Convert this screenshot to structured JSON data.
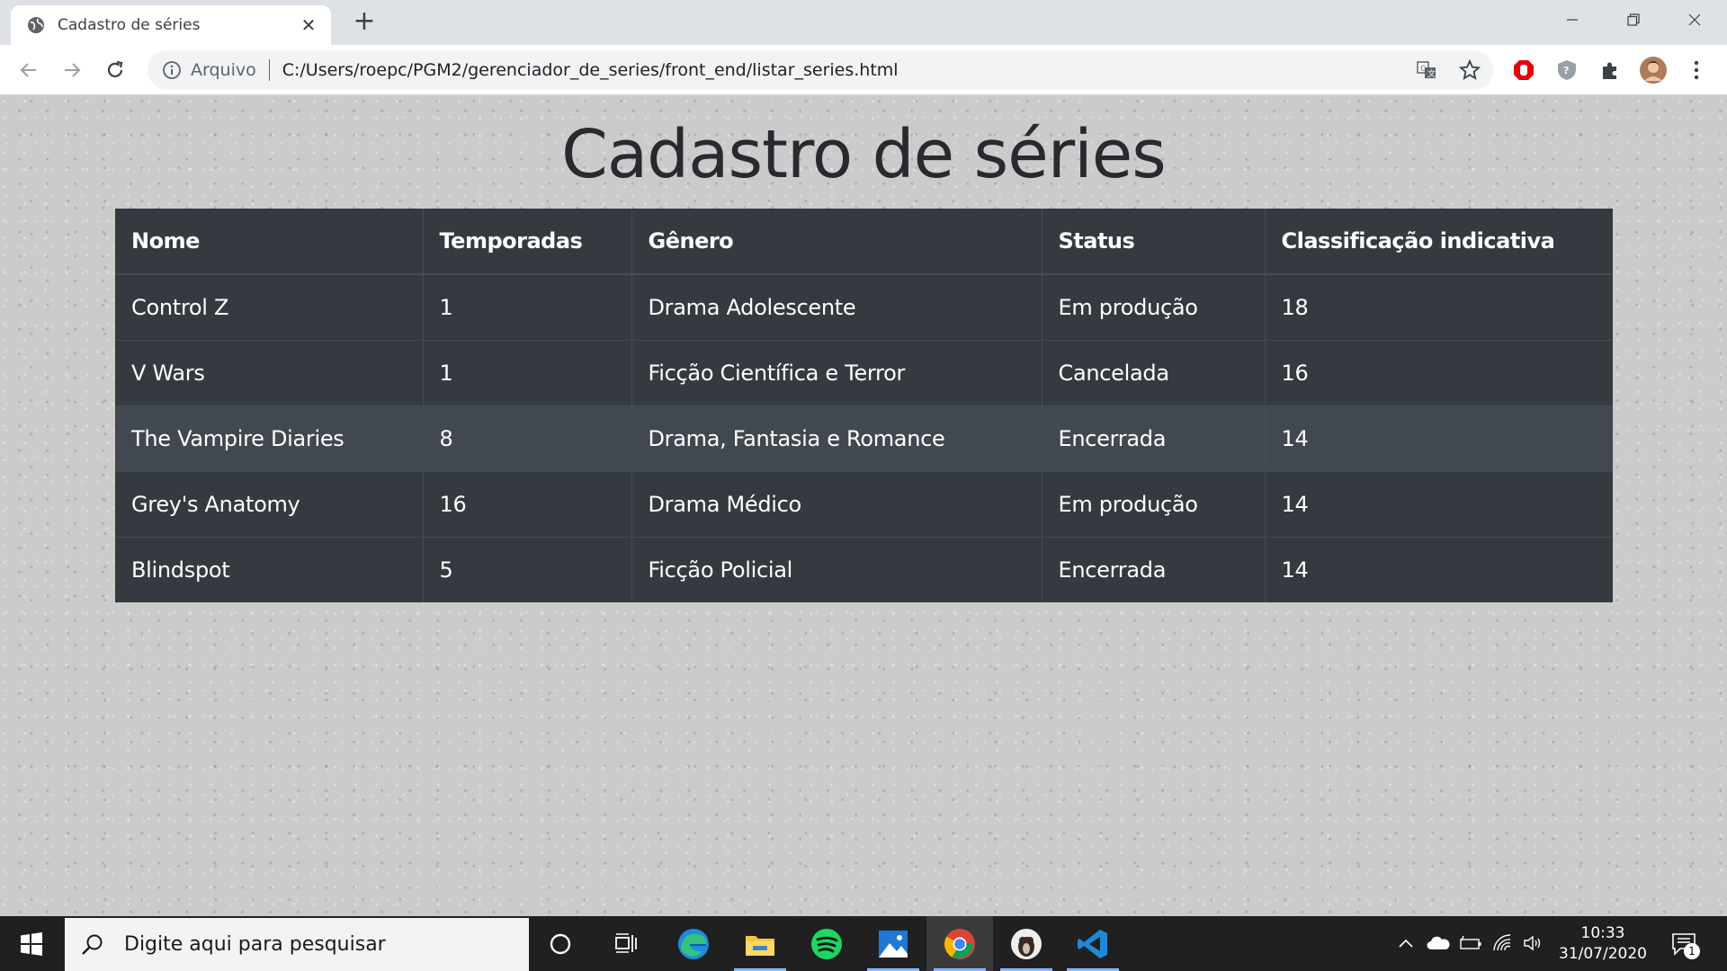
{
  "browser": {
    "tab_title": "Cadastro de séries",
    "close_tab_glyph": "✕",
    "new_tab_glyph": "+",
    "security_label": "Arquivo",
    "url": "C:/Users/roepc/PGM2/gerenciador_de_series/front_end/listar_series.html",
    "icons": [
      "globe-icon",
      "back-icon",
      "forward-icon",
      "reload-icon",
      "info-icon",
      "translate-icon",
      "star-icon",
      "adblock-icon",
      "shield-icon",
      "extensions-icon",
      "profile-avatar",
      "menu-icon"
    ]
  },
  "page": {
    "heading": "Cadastro de séries",
    "table": {
      "headers": [
        "Nome",
        "Temporadas",
        "Gênero",
        "Status",
        "Classificação indicativa"
      ],
      "rows": [
        [
          "Control Z",
          "1",
          "Drama Adolescente",
          "Em produção",
          "18"
        ],
        [
          "V Wars",
          "1",
          "Ficção Científica e Terror",
          "Cancelada",
          "16"
        ],
        [
          "The Vampire Diaries",
          "8",
          "Drama, Fantasia e Romance",
          "Encerrada",
          "14"
        ],
        [
          "Grey's Anatomy",
          "16",
          "Drama Médico",
          "Em produção",
          "14"
        ],
        [
          "Blindspot",
          "5",
          "Ficção Policial",
          "Encerrada",
          "14"
        ]
      ],
      "highlighted_row": 2,
      "colors": {
        "table_bg": "#343a40",
        "row_hover": "#42484f",
        "border": "#454d55",
        "text": "#ffffff"
      }
    }
  },
  "taskbar": {
    "search_placeholder": "Digite aqui para pesquisar",
    "apps": [
      "cortana-icon",
      "task-view-icon",
      "edge-icon",
      "file-explorer-icon",
      "spotify-icon",
      "photos-icon",
      "chrome-icon",
      "app-avatar-icon",
      "vscode-icon"
    ],
    "clock_time": "10:33",
    "clock_date": "31/07/2020",
    "notification_count": "1"
  }
}
